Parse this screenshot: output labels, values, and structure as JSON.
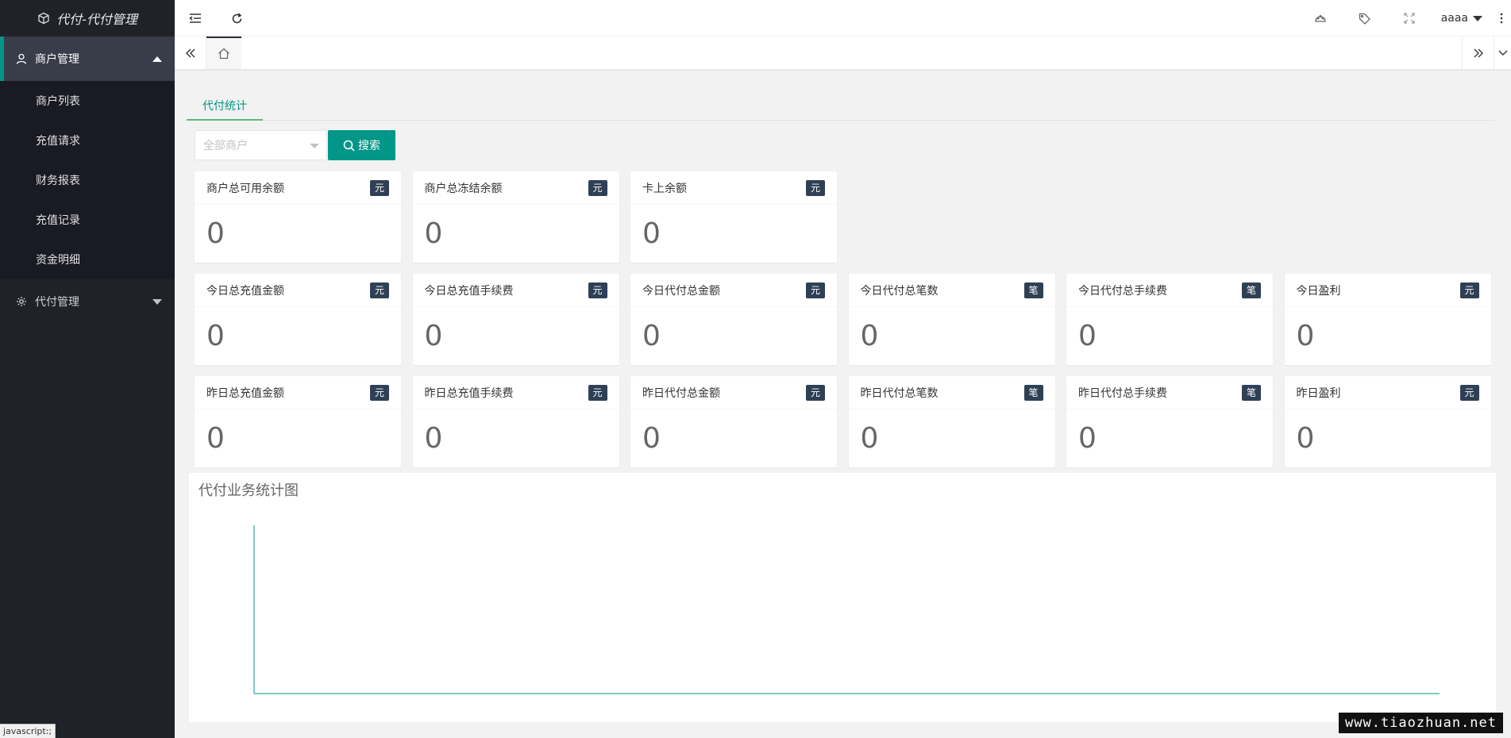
{
  "sidebar": {
    "logo_text": "代付-代付管理",
    "groups": [
      {
        "title": "商户管理",
        "items": [
          {
            "label": "商户列表"
          },
          {
            "label": "充值请求"
          },
          {
            "label": "财务报表"
          },
          {
            "label": "充值记录"
          },
          {
            "label": "资金明细"
          }
        ]
      },
      {
        "title": "代付管理"
      }
    ]
  },
  "header": {
    "user_name": "aaaa",
    "icons": [
      "menu-collapse-icon",
      "refresh-icon",
      "theme-icon",
      "tag-icon",
      "fullscreen-icon",
      "more-icon"
    ]
  },
  "tabs": {
    "home_icon": "home-icon"
  },
  "main": {
    "subtab": "代付统计",
    "select_placeholder": "全部商户",
    "search_label": "搜索",
    "rows": [
      [
        {
          "label": "商户总可用余额",
          "unit": "元",
          "value": "0"
        },
        {
          "label": "商户总冻结余额",
          "unit": "元",
          "value": "0"
        },
        {
          "label": "卡上余额",
          "unit": "元",
          "value": "0"
        }
      ],
      [
        {
          "label": "今日总充值金额",
          "unit": "元",
          "value": "0"
        },
        {
          "label": "今日总充值手续费",
          "unit": "元",
          "value": "0"
        },
        {
          "label": "今日代付总金额",
          "unit": "元",
          "value": "0"
        },
        {
          "label": "今日代付总笔数",
          "unit": "笔",
          "value": "0"
        },
        {
          "label": "今日代付总手续费",
          "unit": "笔",
          "value": "0"
        },
        {
          "label": "今日盈利",
          "unit": "元",
          "value": "0"
        }
      ],
      [
        {
          "label": "昨日总充值金额",
          "unit": "元",
          "value": "0"
        },
        {
          "label": "昨日总充值手续费",
          "unit": "元",
          "value": "0"
        },
        {
          "label": "昨日代付总金额",
          "unit": "元",
          "value": "0"
        },
        {
          "label": "昨日代付总笔数",
          "unit": "笔",
          "value": "0"
        },
        {
          "label": "昨日代付总手续费",
          "unit": "笔",
          "value": "0"
        },
        {
          "label": "昨日盈利",
          "unit": "元",
          "value": "0"
        }
      ]
    ],
    "chart_title": "代付业务统计图"
  },
  "chart_data": {
    "type": "line",
    "title": "代付业务统计图",
    "categories": [],
    "series": [],
    "axis_color": "#009688"
  },
  "status_tip": "javascript:;",
  "watermark": "www.tiaozhuan.net",
  "colors": {
    "accent": "#009688",
    "sidebar_bg": "#20222a",
    "badge_bg": "#2f4056"
  }
}
